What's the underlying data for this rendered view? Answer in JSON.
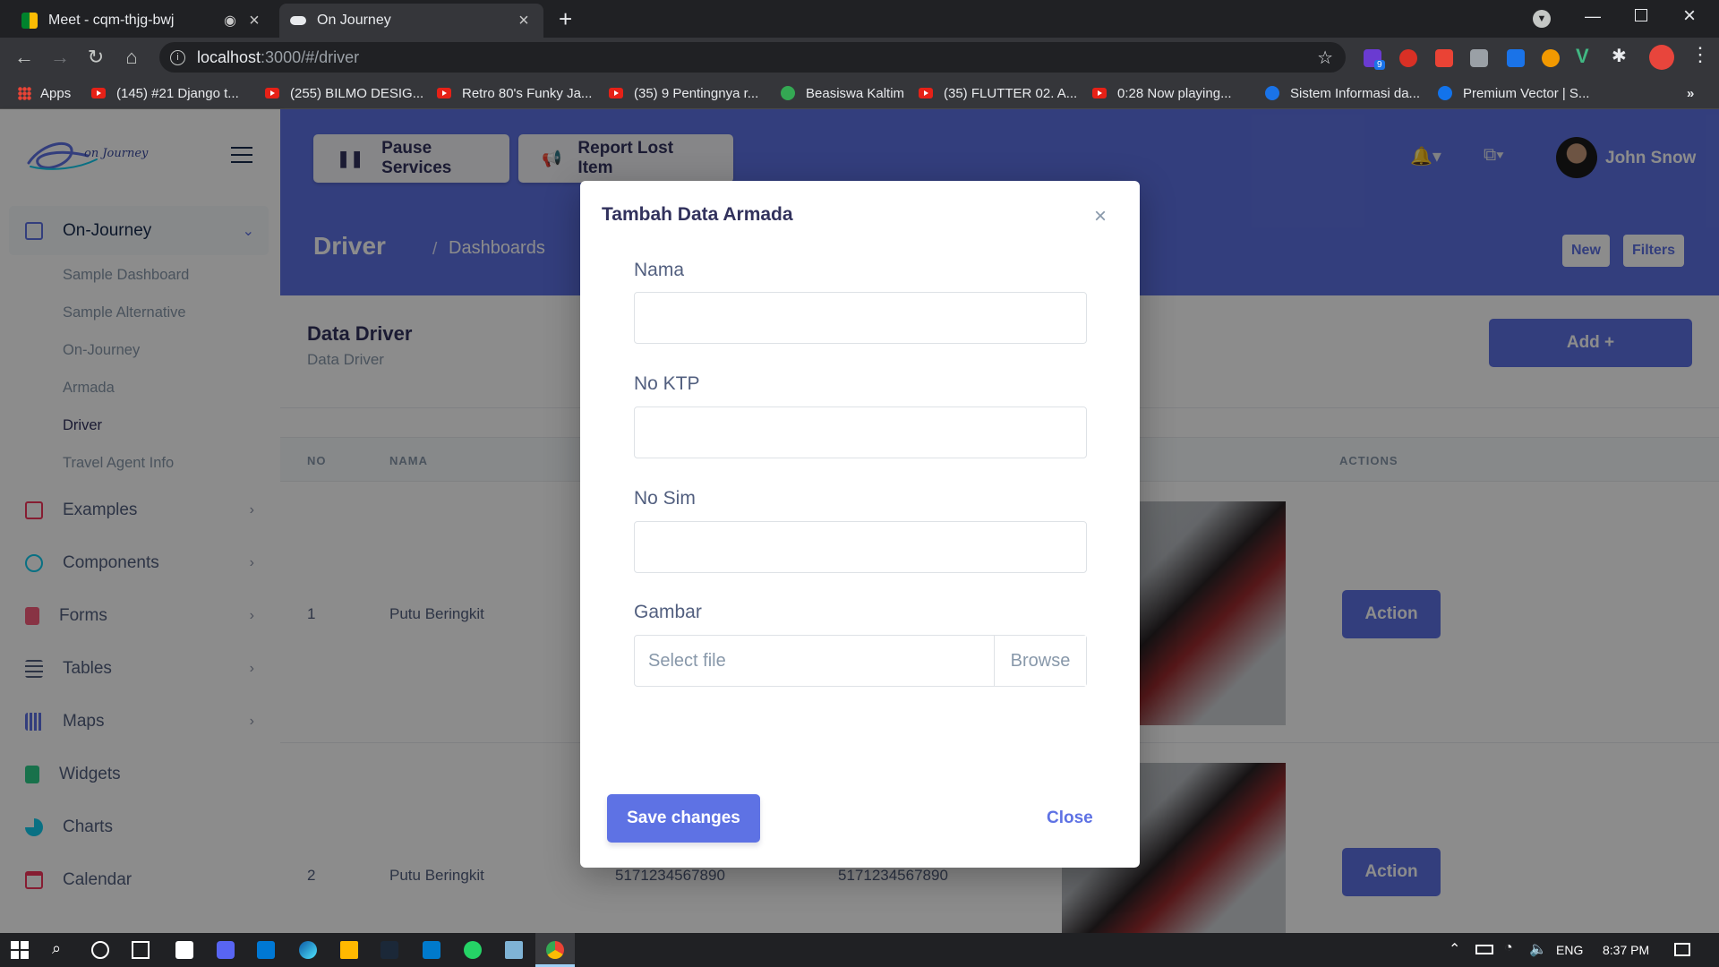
{
  "browser": {
    "tabs": [
      {
        "title": "Meet - cqm-thjg-bwj",
        "active": false
      },
      {
        "title": "On Journey",
        "active": true
      }
    ],
    "url_host": "localhost",
    "url_path": ":3000/#/driver",
    "bookmarks": [
      "Apps",
      "(145) #21 Django t...",
      "(255) BILMO DESIG...",
      "Retro 80's Funky Ja...",
      "(35) 9 Pentingnya r...",
      "Beasiswa Kaltim",
      "(35) FLUTTER 02. A...",
      "0:28 Now playing...",
      "Sistem Informasi da...",
      "Premium Vector | S..."
    ],
    "extension_badge": "9"
  },
  "sidebar": {
    "brand": "on Journey",
    "menu": [
      {
        "label": "On-Journey",
        "icon": "shop-icon",
        "color": "#5e72e4"
      },
      {
        "label": "Examples",
        "icon": "ungroup-icon",
        "color": "#f5365c"
      },
      {
        "label": "Components",
        "icon": "components-icon",
        "color": "#11cdef"
      },
      {
        "label": "Forms",
        "icon": "forms-icon",
        "color": "#f5365c"
      },
      {
        "label": "Tables",
        "icon": "tables-icon",
        "color": "#525f7f"
      },
      {
        "label": "Maps",
        "icon": "map-icon",
        "color": "#5e72e4"
      },
      {
        "label": "Widgets",
        "icon": "widgets-icon",
        "color": "#2dce89"
      },
      {
        "label": "Charts",
        "icon": "pie-chart-icon",
        "color": "#11cdef"
      },
      {
        "label": "Calendar",
        "icon": "calendar-icon",
        "color": "#f5365c"
      }
    ],
    "submenu": [
      "Sample Dashboard",
      "Sample Alternative",
      "On-Journey",
      "Armada",
      "Driver",
      "Travel Agent Info"
    ]
  },
  "header": {
    "pause_label": "Pause Services",
    "report_label": "Report Lost Item",
    "user_name": "John Snow",
    "page_title": "Driver",
    "breadcrumb_sep": "/",
    "breadcrumb": "Dashboards",
    "new_label": "New",
    "filters_label": "Filters"
  },
  "card": {
    "title": "Data Driver",
    "subtitle": "Data Driver",
    "add_label": "Add +",
    "columns": [
      "NO",
      "NAMA",
      "ACTIONS"
    ],
    "rows": [
      {
        "no": "1",
        "nama": "Putu Beringkit",
        "ktp": "",
        "sim": "",
        "action": "Action"
      },
      {
        "no": "2",
        "nama": "Putu Beringkit",
        "ktp": "5171234567890",
        "sim": "5171234567890",
        "action": "Action"
      }
    ]
  },
  "modal": {
    "title": "Tambah Data Armada",
    "close_x": "×",
    "fields": [
      {
        "label": "Nama",
        "value": ""
      },
      {
        "label": "No KTP",
        "value": ""
      },
      {
        "label": "No Sim",
        "value": ""
      }
    ],
    "file_label": "Gambar",
    "file_placeholder": "Select file",
    "browse_label": "Browse",
    "save_label": "Save changes",
    "close_label": "Close"
  },
  "taskbar": {
    "lang": "ENG",
    "time": "8:37 PM"
  }
}
